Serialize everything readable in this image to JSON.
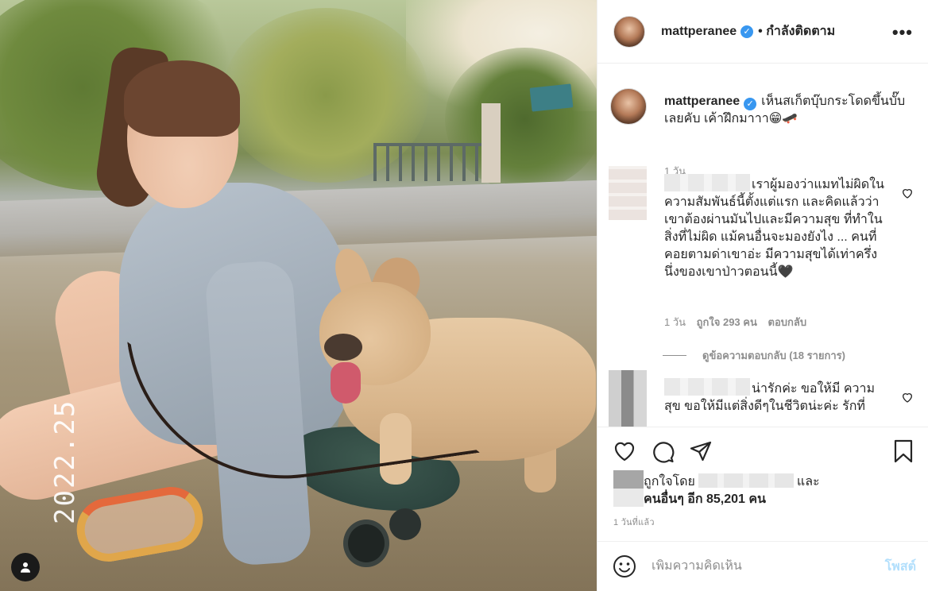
{
  "post": {
    "photo_watermark": "2022.25",
    "username": "mattperanee",
    "verified_mark": "✓",
    "follow_status": "• กำลังติดตาม",
    "more_label": "•••",
    "caption": "เห็นสเก็ตบุ๊บกระโดดขึ้นบั๊บเลยคับ เค้าฝึกมาาา😁🛹",
    "caption_time": "1 วัน"
  },
  "comments": [
    {
      "text": "เราผู้มองว่าแมทไม่ผิดในความสัมพันธ์นี้ตั้งแต่แรก และคิดแล้วว่าเขาต้องผ่านมันไปและมีความสุข ที่ทำในสิ่งที่ไม่ผิด แม้คนอื่นจะมองยังไง ... คนที่คอยตามด่าเขาอ่ะ มีความสุขได้เท่าครึ่งนึ่งของเขาป่าวตอนนี้🖤",
      "time": "1 วัน",
      "likes": "ถูกใจ 293 คน",
      "reply": "ตอบกลับ",
      "view_replies": "ดูข้อความตอบกลับ (18 รายการ)"
    },
    {
      "text": "น่ารักค่ะ ขอให้มี ความสุข ขอให้มีแต่สิ่งดีๆในชีวิตน่ะค่ะ รักที่"
    }
  ],
  "likes": {
    "prefix": "ถูกใจโดย",
    "suffix": "และ",
    "others": "คนอื่นๆ อีก 85,201 คน"
  },
  "posted_ago": "1 วันที่แล้ว",
  "composer": {
    "placeholder": "เพิ่มความคิดเห็น",
    "post_label": "โพสต์"
  },
  "icons": {
    "like": "heart-icon",
    "comment": "comment-icon",
    "share": "share-icon",
    "save": "bookmark-icon",
    "emoji": "emoji-icon",
    "tag": "user-tag-icon"
  },
  "colors": {
    "verified": "#3897f0",
    "post_button_disabled": "#b2dffc",
    "secondary_text": "#8e8e8e"
  }
}
